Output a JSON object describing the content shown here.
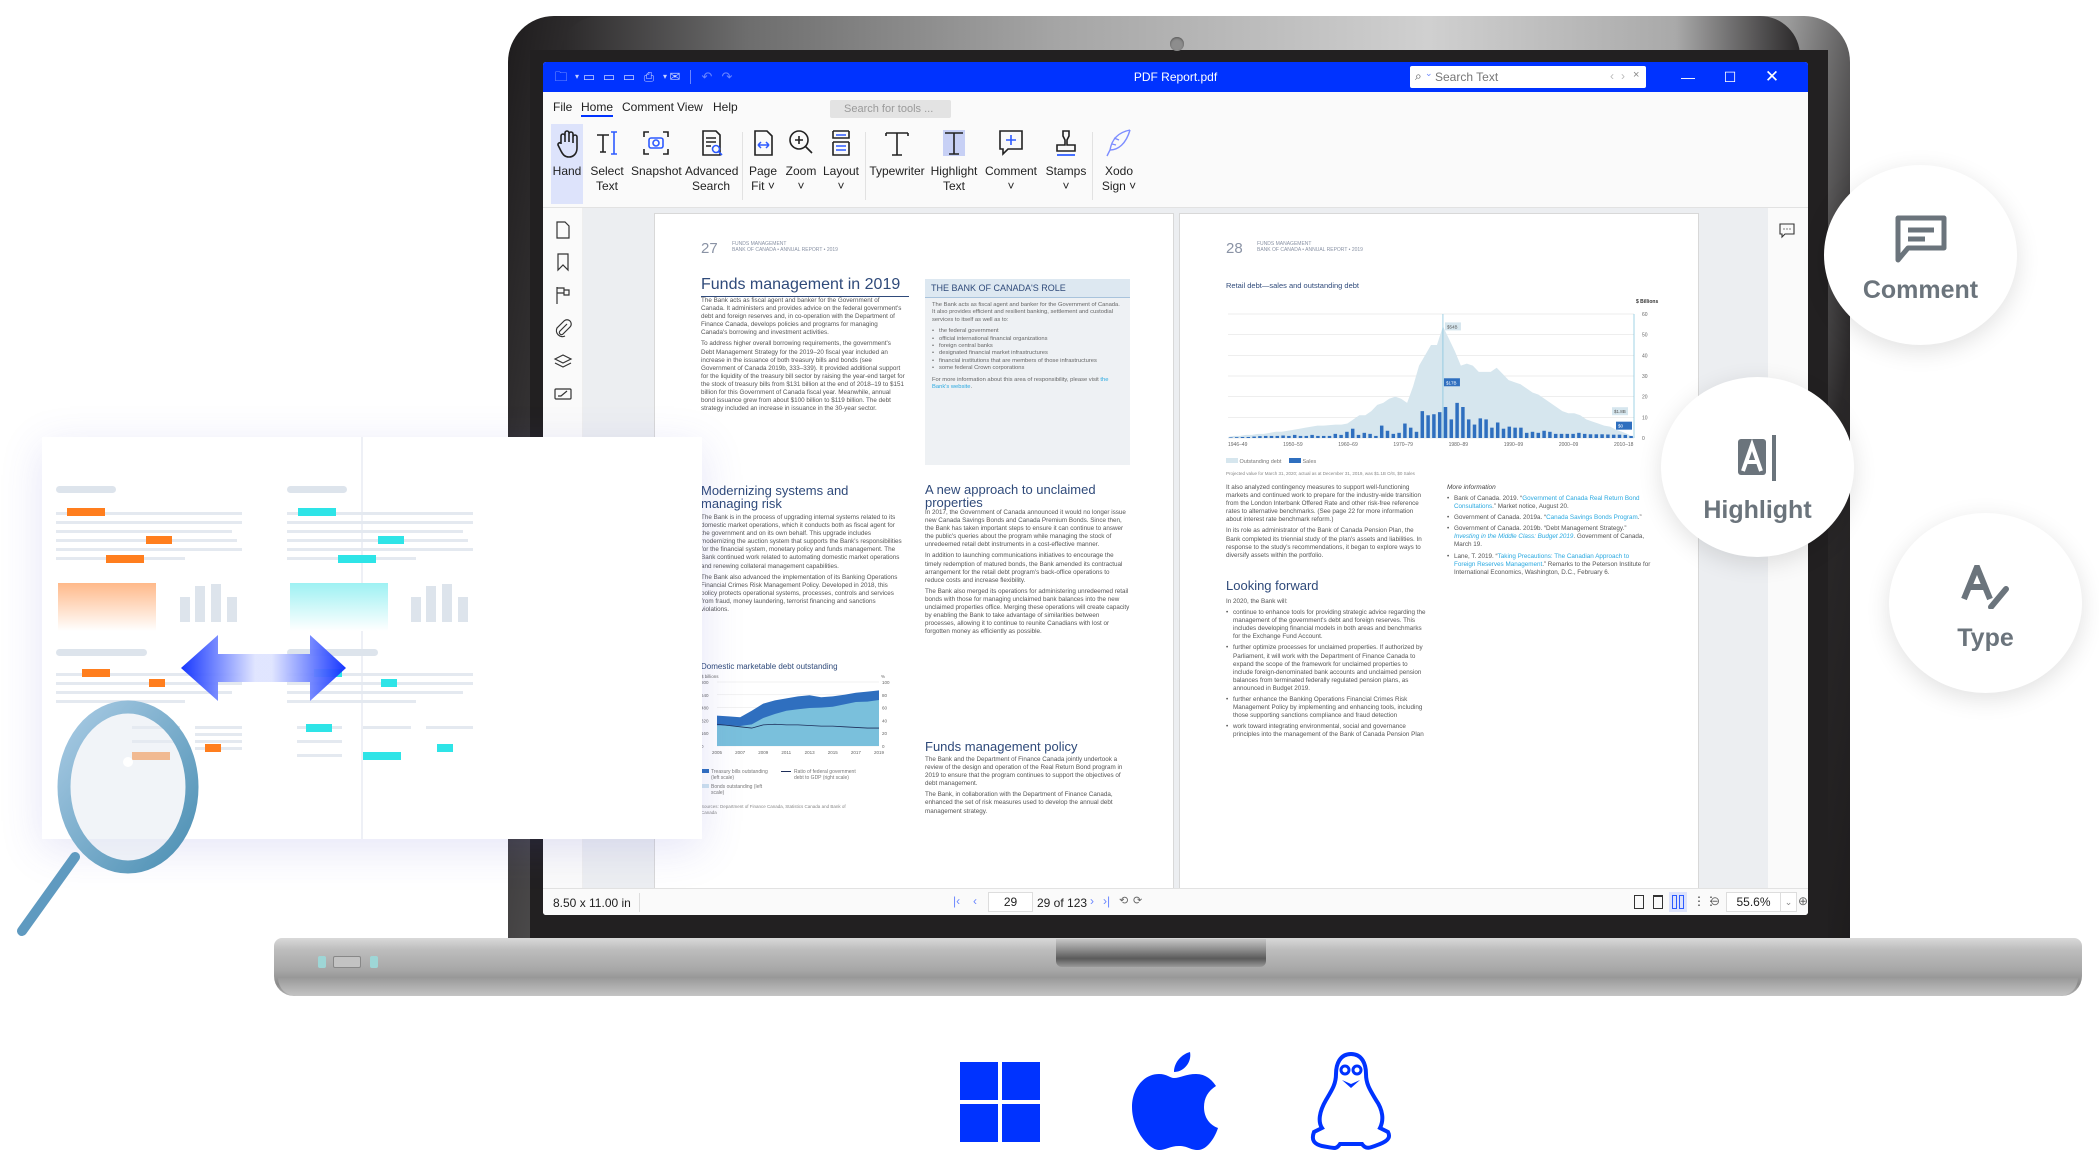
{
  "window": {
    "title": "PDF Report.pdf",
    "search_placeholder": "Search Text",
    "controls": [
      "minimize",
      "maximize",
      "close"
    ]
  },
  "quick_access": [
    "open-icon",
    "save-icon",
    "save-as-icon",
    "save-copy-icon",
    "print-icon",
    "email-icon",
    "undo-icon",
    "redo-icon"
  ],
  "menu": {
    "items": [
      "File",
      "Home",
      "Comment",
      "View",
      "Help"
    ],
    "active": "Home",
    "tool_search_placeholder": "Search for tools ..."
  },
  "ribbon": {
    "tools": [
      {
        "id": "hand",
        "label1": "Hand",
        "label2": "",
        "active": true
      },
      {
        "id": "select-text",
        "label1": "Select",
        "label2": "Text"
      },
      {
        "id": "snapshot",
        "label1": "Snapshot",
        "label2": ""
      },
      {
        "id": "advanced-search",
        "label1": "Advanced",
        "label2": "Search"
      },
      {
        "id": "page-fit",
        "label1": "Page",
        "label2": "Fit ˅"
      },
      {
        "id": "zoom",
        "label1": "Zoom",
        "label2": "˅"
      },
      {
        "id": "layout",
        "label1": "Layout",
        "label2": "˅"
      },
      {
        "id": "typewriter",
        "label1": "Typewriter",
        "label2": ""
      },
      {
        "id": "highlight-text",
        "label1": "Highlight",
        "label2": "Text"
      },
      {
        "id": "comment",
        "label1": "Comment",
        "label2": "˅"
      },
      {
        "id": "stamps",
        "label1": "Stamps",
        "label2": "˅"
      },
      {
        "id": "xodo-sign",
        "label1": "Xodo",
        "label2": "Sign ˅"
      }
    ]
  },
  "left_panel": [
    "page-thumbnails-icon",
    "bookmark-icon",
    "flag-icon",
    "attachment-icon",
    "layers-icon",
    "signature-icon"
  ],
  "status": {
    "page_size": "8.50 x 11.00 in",
    "current_page": "29",
    "page_of": "29 of 123",
    "zoom": "55.6%"
  },
  "page27": {
    "number": "27",
    "header1": "FUNDS MANAGEMENT",
    "header2": "BANK OF CANADA • ANNUAL REPORT • 2019",
    "title": "Funds management in 2019",
    "p1": "The Bank acts as fiscal agent and banker for the Government of Canada. It administers and provides advice on the federal government's debt and foreign reserves and, in co-operation with the Department of Finance Canada, develops policies and programs for managing Canada's borrowing and investment activities.",
    "p2": "To address higher overall borrowing requirements, the government's Debt Management Strategy for the 2019–20 fiscal year included an increase in the issuance of both treasury bills and bonds (see Government of Canada 2019b, 333–339). It provided additional support for the liquidity of the treasury bill sector by raising the year-end target for the stock of treasury bills from $131 billion at the end of 2018–19 to $151 billion for this Government of Canada fiscal year. Meanwhile, annual bond issuance grew from about $100 billion to $119 billion. The debt strategy included an increase in issuance in the 30-year sector.",
    "h_modern": "Modernizing systems and managing risk",
    "p3": "The Bank is in the process of upgrading internal systems related to its domestic market operations, which it conducts both as fiscal agent for the government and on its own behalf. This upgrade includes modernizing the auction system that supports the Bank's responsibilities for the financial system, monetary policy and funds management. The Bank continued work related to automating domestic market operations and renewing collateral management capabilities.",
    "p4": "The Bank also advanced the implementation of its Banking Operations Financial Crimes Risk Management Policy. Developed in 2018, this policy protects operational systems, processes, controls and services from fraud, money laundering, terrorist financing and sanctions violations.",
    "box_title": "THE BANK OF CANADA'S ROLE",
    "box_intro": "The Bank acts as fiscal agent and banker for the Government of Canada. It also provides efficient and resilient banking, settlement and custodial services to itself as well as to:",
    "box_items": [
      "the federal government",
      "official international financial organizations",
      "foreign central banks",
      "designated financial market infrastructures",
      "financial institutions that are members of those infrastructures",
      "some federal Crown corporations"
    ],
    "box_outro": "For more information about this area of responsibility, please visit ",
    "box_link": "the Bank's website",
    "h_unclaimed": "A new approach to unclaimed properties",
    "p5": "In 2017, the Government of Canada announced it would no longer issue new Canada Savings Bonds and Canada Premium Bonds. Since then, the Bank has taken important steps to ensure it can continue to answer the public's queries about the program while managing the stock of unredeemed retail debt instruments in a cost-effective manner.",
    "p6": "In addition to launching communications initiatives to encourage the timely redemption of matured bonds, the Bank amended its contractual arrangement for the retail debt program's back-office operations to reduce costs and increase flexibility.",
    "p7": "The Bank also merged its operations for administering unredeemed retail bonds with those for managing unclaimed bank balances into the new unclaimed properties office. Merging these operations will create capacity by enabling the Bank to take advantage of similarities between processes, allowing it to continue to reunite Canadians with lost or forgotten money as efficiently as possible.",
    "h_policy": "Funds management policy",
    "p8": "The Bank and the Department of Finance Canada jointly undertook a review of the design and operation of the Real Return Bond program in 2019 to ensure that the program continues to support the objectives of debt management.",
    "p9": "The Bank, in collaboration with the Department of Finance Canada, enhanced the set of risk measures used to develop the annual debt management strategy.",
    "sources": "Sources: Department of Finance Canada, Statistics Canada and Bank of Canada"
  },
  "page28": {
    "number": "28",
    "header1": "FUNDS MANAGEMENT",
    "header2": "BANK OF CANADA • ANNUAL REPORT • 2019",
    "p1": "It also analyzed contingency measures to support well-functioning markets and continued work to prepare for the industry-wide transition from the London Interbank Offered Rate and other risk-free reference rates to alternative benchmarks. (See page 22 for more information about interest rate benchmark reform.)",
    "p2": "In its role as administrator of the Bank of Canada Pension Plan, the Bank completed its triennial study of the plan's assets and liabilities. In response to the study's recommendations, it began to explore ways to diversify assets within the portfolio.",
    "h_forward": "Looking forward",
    "p3": "In 2020, the Bank will:",
    "items": [
      "continue to enhance tools for providing strategic advice regarding the management of the government's debt and foreign reserves. This includes developing financial models in both areas and benchmarks for the Exchange Fund Account.",
      "further optimize processes for unclaimed properties. If authorized by Parliament, it will work with the Department of Finance Canada to expand the scope of the framework for unclaimed properties to include foreign-denominated bank accounts and unclaimed pension balances from terminated federally regulated pension plans, as announced in Budget 2019.",
      "further enhance the Banking Operations Financial Crimes Risk Management Policy by implementing and enhancing tools, including those supporting sanctions compliance and fraud detection",
      "work toward integrating environmental, social and governance principles into the management of the Bank of Canada Pension Plan"
    ],
    "more_title": "More information",
    "refs": [
      {
        "pre": "Bank of Canada. 2019. “",
        "link": "Government of Canada Real Return Bond Consultations",
        "post": ".” Market notice, August 20."
      },
      {
        "pre": "Government of Canada. 2019a. “",
        "link": "Canada Savings Bonds Program",
        "post": ".”"
      },
      {
        "pre": "Government of Canada. 2019b. “Debt Management Strategy.” ",
        "link": "Investing in the Middle Class: Budget 2019",
        "post": ". Government of Canada, March 19."
      },
      {
        "pre": "Lane, T. 2019. “",
        "link": "Taking Precautions: The Canadian Approach to Foreign Reserves Management",
        "post": ".” Remarks to the Peterson Institute for International Economics, Washington, D.C., February 6."
      }
    ],
    "footnote": "Projected value for March 31, 2020; actual as at December 31, 2019, was $1.1B O/S, $0 Sales"
  },
  "chart_data": [
    {
      "type": "area",
      "title": "Domestic marketable debt outstanding",
      "ylabel": "$ billions",
      "y2label": "%",
      "ylim": [
        0,
        800
      ],
      "y2lim": [
        0,
        100
      ],
      "yticks": [
        "0",
        "160",
        "320",
        "480",
        "640",
        "800"
      ],
      "y2ticks": [
        "0",
        "20",
        "40",
        "60",
        "80",
        "100"
      ],
      "xticks": [
        "2005",
        "2007",
        "2009",
        "2011",
        "2013",
        "2015",
        "2017",
        "2019"
      ],
      "x": [
        2005,
        2006,
        2007,
        2008,
        2009,
        2010,
        2011,
        2012,
        2013,
        2014,
        2015,
        2016,
        2017,
        2018,
        2019
      ],
      "series": [
        {
          "name": "Bonds outstanding (left scale)",
          "values": [
            260,
            255,
            250,
            270,
            350,
            400,
            440,
            460,
            475,
            480,
            490,
            520,
            550,
            555,
            575
          ]
        },
        {
          "name": "Treasury bills outstanding (left scale)",
          "values": [
            120,
            115,
            110,
            170,
            180,
            170,
            155,
            160,
            160,
            130,
            130,
            120,
            115,
            125,
            120
          ]
        },
        {
          "name": "Ratio of federal government debt to GDP (right scale)",
          "axis": "right",
          "values": [
            34,
            32,
            30,
            28,
            33,
            34,
            33,
            33,
            32,
            31,
            31,
            30,
            29,
            28,
            28
          ]
        }
      ],
      "legend": [
        "Treasury bills outstanding (left scale)",
        "Bonds outstanding (left scale)",
        "Ratio of federal government debt to GDP (right scale)"
      ]
    },
    {
      "type": "bar",
      "title": "Retail debt—sales and outstanding debt",
      "ylabel": "$ Billions",
      "ylim": [
        0,
        60
      ],
      "yticks": [
        "0",
        "10",
        "20",
        "30",
        "40",
        "50",
        "60"
      ],
      "xticks": [
        "1946–49",
        "1950–59",
        "1960–69",
        "1970–79",
        "1980–89",
        "1990–99",
        "2000–09",
        "2010–18"
      ],
      "annotations": [
        "$54B",
        "$17B",
        "$1.8B",
        "$0"
      ],
      "series": [
        {
          "name": "Outstanding debt",
          "type": "area",
          "values": [
            0.5,
            1,
            1,
            1.5,
            1.5,
            2,
            2,
            2.5,
            3,
            3,
            3.5,
            4,
            4.5,
            5,
            5.5,
            6,
            6,
            6.2,
            6.5,
            6.5,
            7,
            9,
            11,
            11,
            13,
            16,
            17,
            19,
            20,
            19,
            17,
            25,
            35,
            40,
            45,
            45,
            54,
            48,
            42,
            35,
            36,
            35,
            32,
            32,
            32,
            34,
            31,
            28,
            27,
            26,
            24,
            22,
            21,
            19,
            17,
            15,
            13,
            12,
            12,
            11,
            9,
            8,
            7,
            6,
            5.5,
            4,
            3,
            1.8,
            0
          ]
        },
        {
          "name": "Sales",
          "type": "bar",
          "values": [
            0.3,
            0.4,
            0.5,
            0.5,
            0.7,
            0.9,
            1,
            1,
            1,
            1.2,
            1,
            1.5,
            1,
            1,
            1.5,
            1,
            1,
            1,
            2,
            1.5,
            3,
            4.5,
            1.5,
            2.5,
            2,
            1,
            6,
            3.5,
            2,
            2.5,
            7,
            5,
            3,
            13,
            11,
            11.5,
            12.5,
            15,
            9,
            17,
            15,
            9,
            6.5,
            9.5,
            9,
            5,
            7.5,
            4.5,
            5.5,
            5,
            5,
            2.5,
            3,
            2.5,
            3.5,
            3,
            2,
            2,
            2,
            2,
            2.5,
            2,
            1.8,
            1.8,
            1.8,
            1.7,
            1.6,
            1.6,
            1.5,
            1
          ]
        }
      ],
      "legend": [
        "Outstanding debt",
        "Sales"
      ]
    }
  ],
  "feature_bubbles": [
    {
      "label": "Comment",
      "icon": "comment-icon"
    },
    {
      "label": "Highlight",
      "icon": "highlight-icon"
    },
    {
      "label": "Type",
      "icon": "type-icon"
    }
  ],
  "platforms": [
    "windows-icon",
    "apple-icon",
    "linux-icon"
  ],
  "colors": {
    "brand": "#0033ff",
    "highlight_orange": "#ff7e1e",
    "highlight_cyan": "#2ee4e7",
    "chart_dark": "#2f6fbf",
    "chart_light": "#7ac0dc",
    "chart_pale": "#d6e6ee",
    "heading": "#2f4a7a",
    "bubble_text": "#6b747c"
  }
}
